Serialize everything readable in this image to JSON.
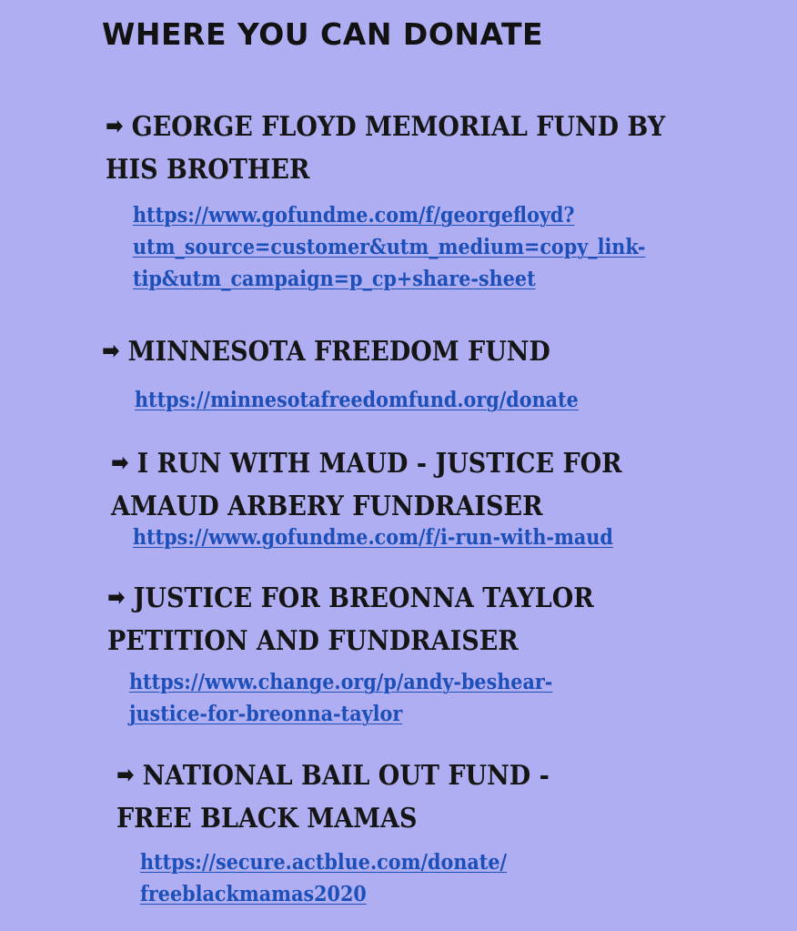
{
  "title": "WHERE YOU CAN DONATE",
  "colors": {
    "background": "#b0aef3",
    "heading_text": "#151515",
    "link": "#1d4fb8"
  },
  "arrow_glyph": "➡",
  "entries": [
    {
      "heading_line1": "GEORGE FLOYD MEMORIAL FUND BY",
      "heading_line2": "HIS BROTHER",
      "link_line1": "https://www.gofundme.com/f/georgefloyd?",
      "link_line2": "utm_source=customer&utm_medium=copy_link-",
      "link_line3": "tip&utm_campaign=p_cp+share-sheet"
    },
    {
      "heading_line1": "MINNESOTA FREEDOM FUND",
      "link_line1": "https://minnesotafreedomfund.org/donate"
    },
    {
      "heading_line1": "I RUN WITH MAUD - JUSTICE FOR",
      "heading_line2": "AMAUD ARBERY FUNDRAISER",
      "link_line1": "https://www.gofundme.com/f/i-run-with-maud"
    },
    {
      "heading_line1": "JUSTICE FOR BREONNA TAYLOR",
      "heading_line2": "PETITION AND FUNDRAISER",
      "link_line1": "https://www.change.org/p/andy-beshear-",
      "link_line2": "justice-for-breonna-taylor"
    },
    {
      "heading_line1": "NATIONAL BAIL OUT FUND -",
      "heading_line2": "FREE BLACK MAMAS",
      "link_line1": "https://secure.actblue.com/donate/",
      "link_line2": "freeblackmamas2020"
    }
  ]
}
